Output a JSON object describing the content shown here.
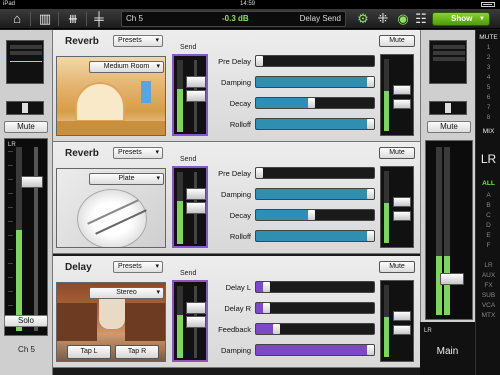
{
  "status_bar": {
    "carrier": "iPad",
    "clock": "14:59"
  },
  "toolbar": {
    "channel": "Ch 5",
    "level": "-0.3 dB",
    "mode": "Delay Send",
    "show_label": "Show",
    "icons": [
      "home-icon",
      "mixer-icon",
      "fader-icon",
      "gear-icon",
      "routing-icon",
      "record-icon",
      "users-icon"
    ]
  },
  "left_strip": {
    "mute_label": "Mute",
    "fader_label": "LR",
    "solo_label": "Solo",
    "channel_name": "Ch 5",
    "meter_level": 0.55,
    "fader_position": 0.85
  },
  "fx_rows": [
    {
      "title": "Reverb",
      "presets_label": "Presets",
      "preset_value": "Medium Room",
      "send_label": "Send",
      "mute_label": "Mute",
      "image": "room-image",
      "params": [
        {
          "label": "Pre Delay",
          "value": 0.0,
          "color": "#1b1b1b"
        },
        {
          "label": "Damping",
          "value": 1.0,
          "color": "#2f8fb2"
        },
        {
          "label": "Decay",
          "value": 0.5,
          "color": "#2f8fb2"
        },
        {
          "label": "Rolloff",
          "value": 1.0,
          "color": "#2f8fb2"
        }
      ]
    },
    {
      "title": "Reverb",
      "presets_label": "Presets",
      "preset_value": "Plate",
      "send_label": "Send",
      "mute_label": "Mute",
      "image": "plate-image",
      "params": [
        {
          "label": "Pre Delay",
          "value": 0.0,
          "color": "#1b1b1b"
        },
        {
          "label": "Damping",
          "value": 1.0,
          "color": "#2f8fb2"
        },
        {
          "label": "Decay",
          "value": 0.5,
          "color": "#2f8fb2"
        },
        {
          "label": "Rolloff",
          "value": 1.0,
          "color": "#2f8fb2"
        }
      ]
    },
    {
      "title": "Delay",
      "presets_label": "Presets",
      "preset_value": "Stereo",
      "send_label": "Send",
      "mute_label": "Mute",
      "image": "canyon-image",
      "tap_l": "Tap L",
      "tap_r": "Tap R",
      "params": [
        {
          "label": "Delay L",
          "value": 0.12,
          "color": "#7d49c9"
        },
        {
          "label": "Delay R",
          "value": 0.12,
          "color": "#7d49c9"
        },
        {
          "label": "Feedback",
          "value": 0.2,
          "color": "#7d49c9"
        },
        {
          "label": "Damping",
          "value": 1.0,
          "color": "#7d49c9"
        }
      ]
    }
  ],
  "main_strip": {
    "mute_label": "Mute",
    "lr_label": "LR",
    "name": "Main"
  },
  "sidebar": {
    "items": [
      "MUTE",
      "1",
      "2",
      "3",
      "4",
      "5",
      "6",
      "7",
      "8",
      "MIX",
      "LR",
      "ALL",
      "A",
      "B",
      "C",
      "D",
      "E",
      "F",
      "LR",
      "AUX",
      "FX",
      "SUB",
      "VCA",
      "MTX"
    ]
  }
}
